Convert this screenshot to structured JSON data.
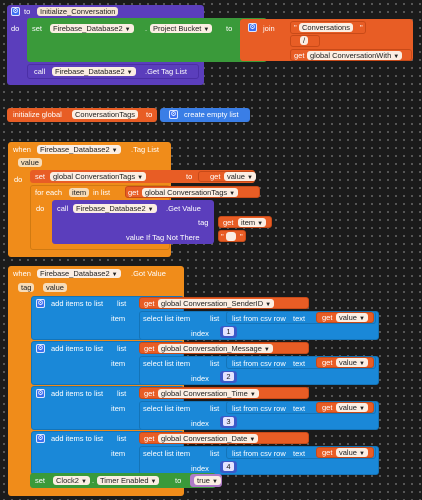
{
  "proc": {
    "to": "to",
    "name": "Initialize_Conversation",
    "do": "do",
    "set": "set",
    "component": "Firebase_Database2",
    "property": "Project Bucket",
    "to_kw": "to",
    "join": "join",
    "s1": "Conversations",
    "s2": "/",
    "get": "get",
    "var_with": "global ConversationWith",
    "call": "call",
    "call_comp": "Firebase_Database2",
    "call_method": ".Get Tag List"
  },
  "init": {
    "label": "initialize global",
    "name": "ConversationTags",
    "to": "to",
    "value": "create empty list"
  },
  "taglist": {
    "when": "when",
    "comp": "Firebase_Database2",
    "event": ".Tag List",
    "param": "value",
    "do": "do",
    "set": "set",
    "var": "global ConversationTags",
    "to": "to",
    "get": "get",
    "get_var": "value",
    "foreach": "for each",
    "item": "item",
    "in_list": "in list",
    "list_var": "global ConversationTags",
    "do2": "do",
    "call": "call",
    "call_comp": "Firebase_Database2",
    "call_method": ".Get Value",
    "tag": "tag",
    "tag_get": "item",
    "vitnt": "value If Tag Not There",
    "empty_text": " "
  },
  "gotvalue": {
    "when": "when",
    "comp": "Firebase_Database2",
    "event": ".Got Value",
    "p1": "tag",
    "p2": "value",
    "do": "do",
    "add": "add items to list",
    "list": "list",
    "item": "item",
    "get": "get",
    "select": "select list item",
    "list_kw": "list",
    "from_csv": "list from csv row",
    "text": "text",
    "value": "value",
    "index": "index",
    "rows": [
      {
        "var": "global Conversation_SenderID",
        "idx": "1"
      },
      {
        "var": "global Conversation_Message",
        "idx": "2"
      },
      {
        "var": "global Conversation_Time",
        "idx": "3"
      },
      {
        "var": "global Conversation_Date",
        "idx": "4"
      }
    ],
    "set": "set",
    "clock": "Clock2",
    "timer": "Timer Enabled",
    "to": "to",
    "true": "true"
  }
}
